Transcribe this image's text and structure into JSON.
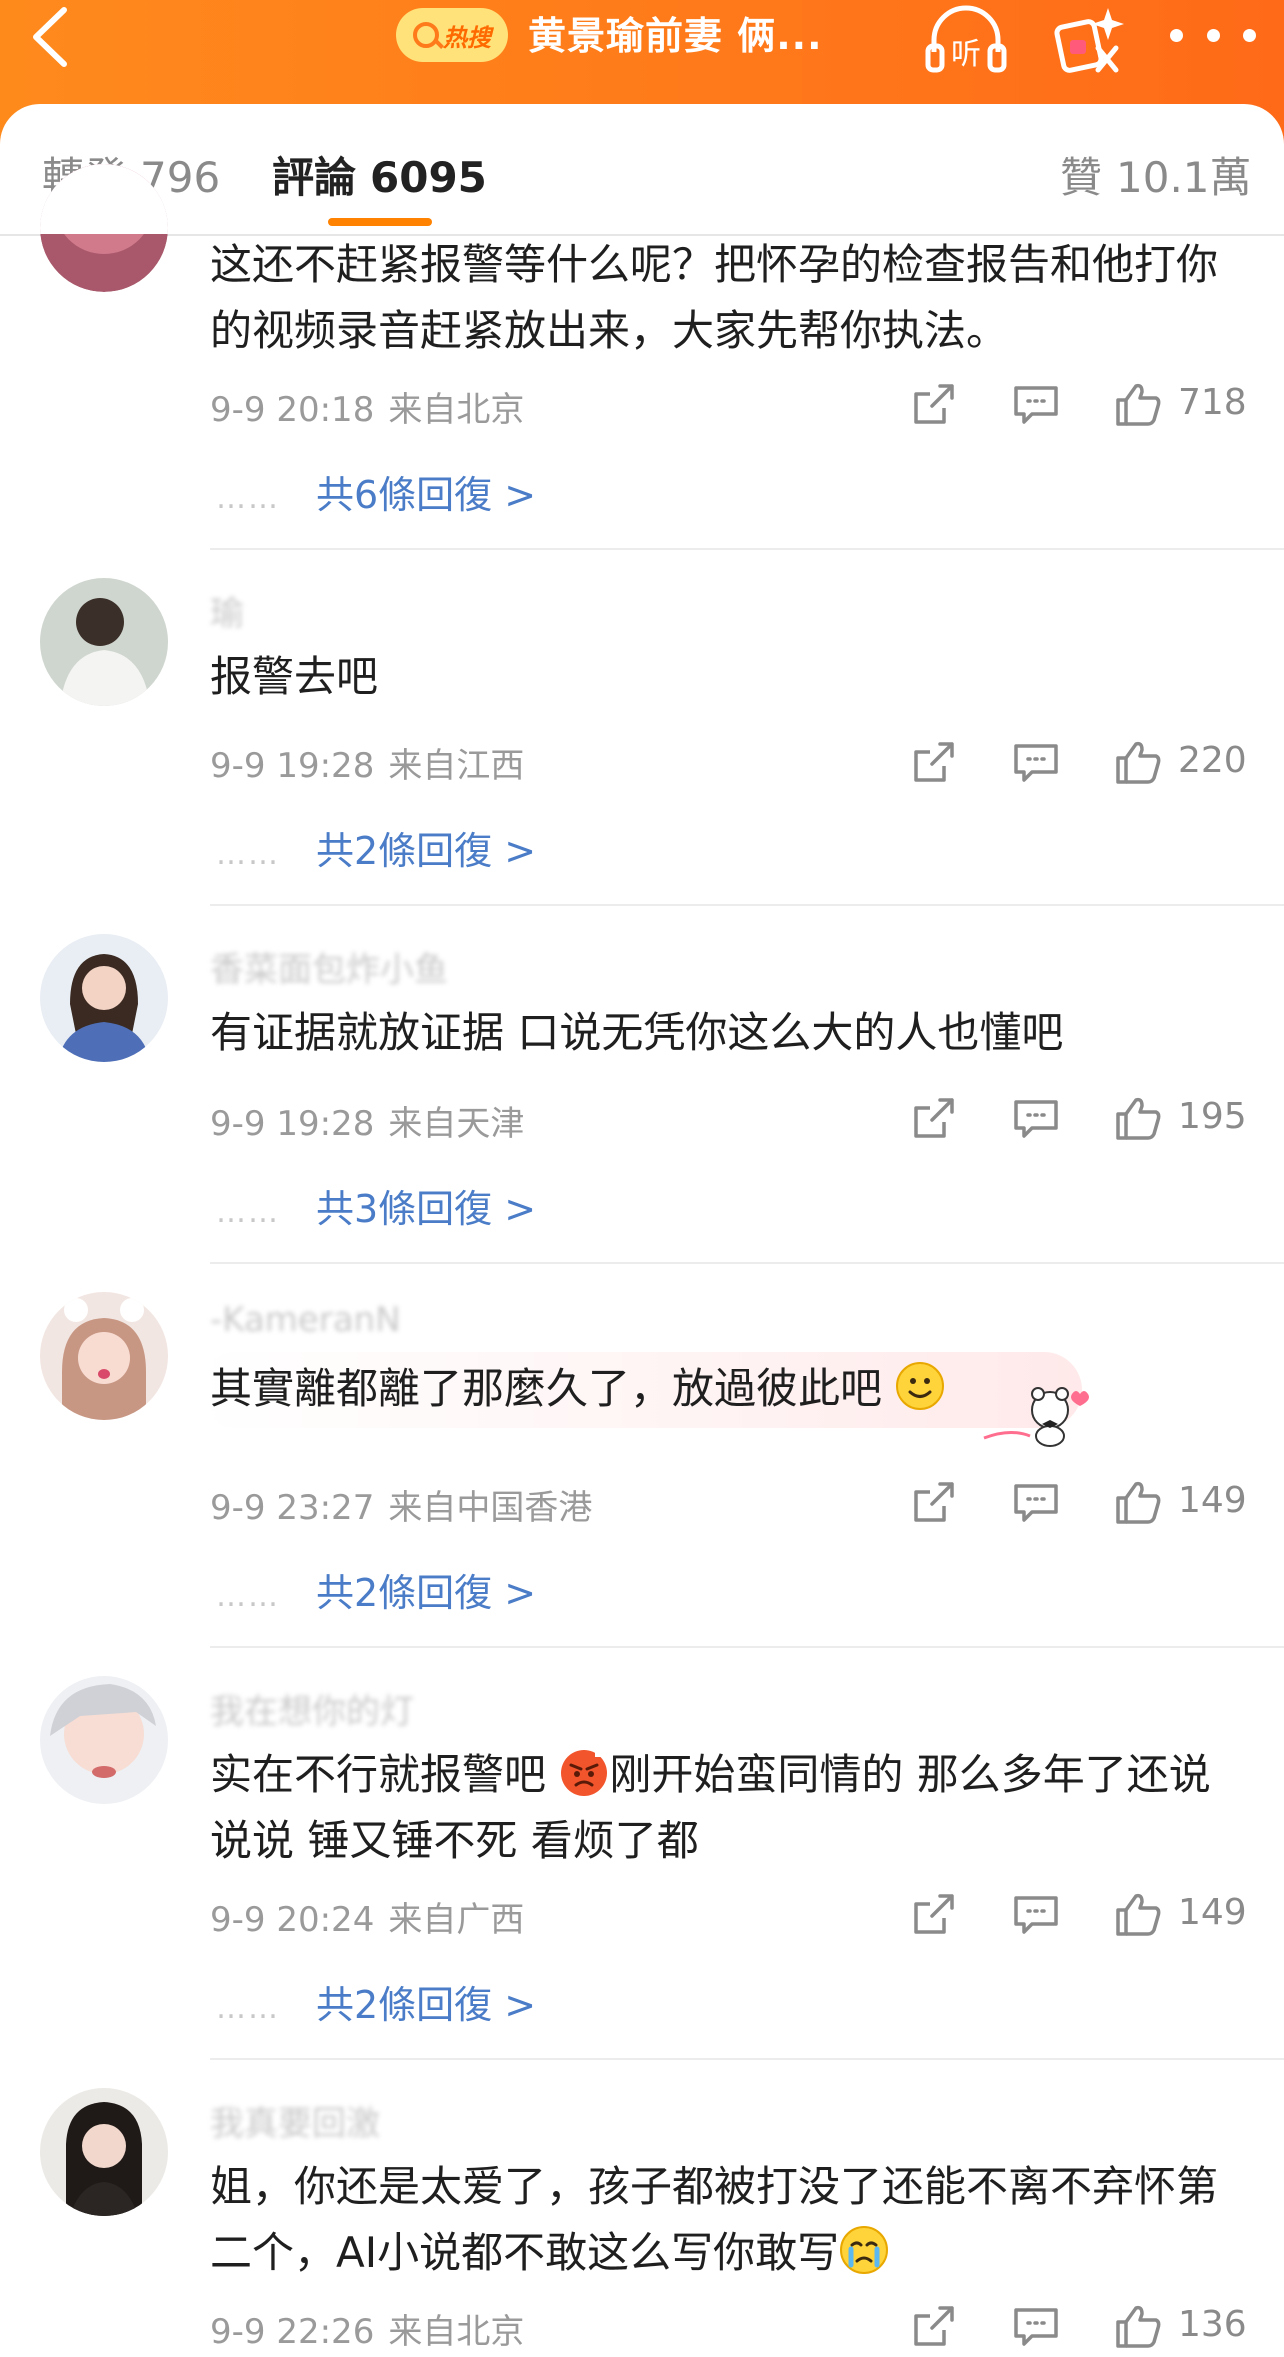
{
  "header": {
    "hot_badge": "热搜",
    "title": "黄景瑜前妻 俩...",
    "listen_label": "听"
  },
  "tabs": {
    "repost_label": "轉發",
    "repost_count": "796",
    "comment_label": "評論",
    "comment_count": "6095",
    "like_label": "贊",
    "like_count": "10.1萬"
  },
  "comments": [
    {
      "username": "",
      "text": "这还不赶紧报警等什么呢？把怀孕的检查报告和他打你的视频录音赶紧放出来，大家先帮你执法。",
      "date": "9-9 20:18",
      "location": "来自北京",
      "likes": "718",
      "replies": "共6條回復 >"
    },
    {
      "username": "瑜",
      "text": "报警去吧",
      "date": "9-9 19:28",
      "location": "来自江西",
      "likes": "220",
      "replies": "共2條回復 >"
    },
    {
      "username": "香菜面包炸小鱼",
      "text": "有证据就放证据 口说无凭你这么大的人也懂吧",
      "date": "9-9 19:28",
      "location": "来自天津",
      "likes": "195",
      "replies": "共3條回復 >"
    },
    {
      "username": "-KameranN",
      "text": "其實離都離了那麼久了，放過彼此吧",
      "date": "9-9 23:27",
      "location": "来自中国香港",
      "likes": "149",
      "replies": "共2條回復 >"
    },
    {
      "username": "我在想你的灯",
      "text_part1": "实在不行就报警吧 ",
      "text_part2": "刚开始蛮同情的 那么多年了还说说说 锤又锤不死 看烦了都",
      "date": "9-9 20:24",
      "location": "来自广西",
      "likes": "149",
      "replies": "共2條回復 >"
    },
    {
      "username": "我真要回激",
      "text": "姐，你还是太爱了，孩子都被打没了还能不离不弃怀第二个，AI小说都不敢这么写你敢写",
      "date": "9-9 22:26",
      "location": "来自北京",
      "likes": "136"
    }
  ],
  "colors": {
    "header_orange": "#ff7a1a",
    "accent": "#ff8200",
    "reply_link": "#4a7cc7"
  },
  "icons": [
    "back-icon",
    "search-icon",
    "headphones-icon",
    "sparkle-icon",
    "more-icon",
    "share-icon",
    "comment-icon",
    "like-icon"
  ]
}
